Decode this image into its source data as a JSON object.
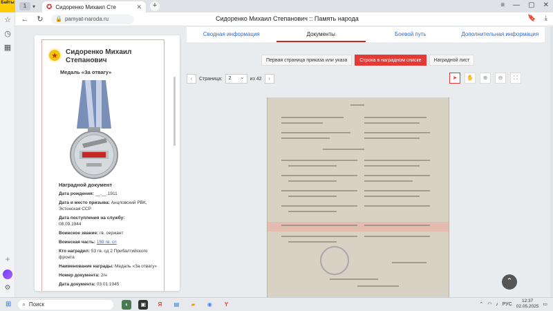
{
  "browser": {
    "logo_text": "Байты",
    "tab_count": "1",
    "tab_title": "Сидоренко Михаил Сте",
    "url": "pamyat-naroda.ru",
    "page_title": "Сидоренко Михаил Степанович :: Память народа"
  },
  "card": {
    "hero_name": "Сидоренко Михаил Степанович",
    "medal_name": "Медаль «За отвагу»",
    "doc_title": "Наградной документ",
    "fields": [
      {
        "label": "Дата рождения:",
        "value": "__.__.1911"
      },
      {
        "label": "Дата и место призыва:",
        "value": "Анцловский РВК, Эстонская ССР"
      },
      {
        "label": "Дата поступления на службу:",
        "value": "08.09.1944"
      },
      {
        "label": "Воинское звание:",
        "value": "гв. сержант"
      },
      {
        "label": "Воинская часть:",
        "value": "159 гв. сп"
      },
      {
        "label": "Кто наградил:",
        "value": "53 гв. сд 2 Прибалтийского фронта"
      },
      {
        "label": "Наименование награды:",
        "value": "Медаль «За отвагу»"
      },
      {
        "label": "Номер документа:",
        "value": "2/н"
      },
      {
        "label": "Дата документа:",
        "value": "03.01.1945"
      }
    ]
  },
  "tabs": [
    "Сводная информация",
    "Документы",
    "Боевой путь",
    "Дополнительная информация"
  ],
  "subtabs": [
    "Первая страница приказа или указа",
    "Строка в наградном списке",
    "Наградной лист"
  ],
  "pager": {
    "label": "Страница:",
    "current": "2",
    "of_label": "из 42"
  },
  "taskbar": {
    "search": "Поиск",
    "lang": "РУС",
    "time": "12:37",
    "date": "02.05.2025"
  }
}
